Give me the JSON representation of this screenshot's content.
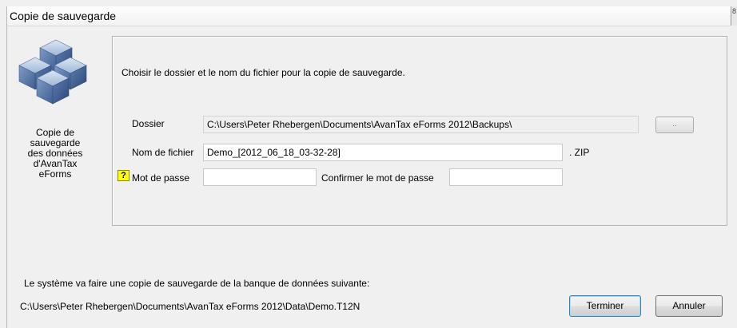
{
  "window": {
    "title": "Copie de sauvegarde",
    "edge_glyph": "8"
  },
  "sidebar": {
    "caption": "Copie de\nsauvegarde\ndes données\nd'AvanTax\neForms",
    "icon": "database-cubes-icon"
  },
  "form": {
    "instruction": "Choisir le dossier et le nom du fichier pour la copie de sauvegarde.",
    "folder_label": "Dossier",
    "folder_value": "C:\\Users\\Peter Rhebergen\\Documents\\AvanTax eForms 2012\\Backups\\",
    "browse_label": "..",
    "filename_label": "Nom de fichier",
    "filename_value": "Demo_[2012_06_18_03-32-28]",
    "extension": ". ZIP",
    "help_glyph": "?",
    "password_label": "Mot de passe",
    "password_value": "",
    "confirm_label": "Confirmer le mot de passe",
    "confirm_value": ""
  },
  "footer": {
    "note": "Le système va faire une copie de sauvegarde de la banque de données suivante:",
    "path": "C:\\Users\\Peter Rhebergen\\Documents\\AvanTax eForms 2012\\Data\\Demo.T12N",
    "finish_label": "Terminer",
    "cancel_label": "Annuler"
  },
  "colors": {
    "help_badge": "#ffff00",
    "panel_border": "#b4b4b4",
    "background": "#f0f0f0"
  }
}
